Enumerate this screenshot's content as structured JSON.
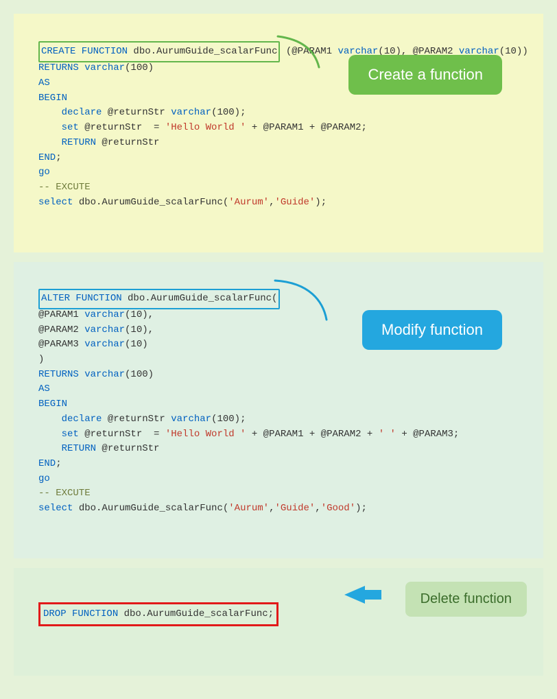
{
  "labels": {
    "create": "Create a function",
    "modify": "Modify function",
    "delete": "Delete function"
  },
  "code": {
    "create": {
      "l1a": "CREATE FUNCTION",
      "l1b": " dbo.AurumGuide_scalarFunc",
      "l1c": " (@PARAM1 ",
      "l1d": "varchar",
      "l1e": "(10), @PARAM2 ",
      "l1f": "varchar",
      "l1g": "(10))",
      "l2a": "RETURNS varchar",
      "l2b": "(100)",
      "l3": "AS",
      "l4": "BEGIN",
      "l5a": "    declare",
      "l5b": " @returnStr ",
      "l5c": "varchar",
      "l5d": "(100);",
      "l6a": "    set",
      "l6b": " @returnStr  = ",
      "l6c": "'Hello World '",
      "l6d": " + @PARAM1 + @PARAM2;",
      "l7a": "    RETURN",
      "l7b": " @returnStr",
      "l8a": "END",
      "l8b": ";",
      "l9": "go",
      "l10": "-- EXCUTE",
      "l11a": "select",
      "l11b": " dbo.AurumGuide_scalarFunc(",
      "l11c": "'Aurum'",
      "l11d": ",",
      "l11e": "'Guide'",
      "l11f": ");"
    },
    "alter": {
      "l1a": "ALTER FUNCTION",
      "l1b": " dbo.AurumGuide_scalarFunc(",
      "l2a": "@PARAM1 ",
      "l2b": "varchar",
      "l2c": "(10),",
      "l3a": "@PARAM2 ",
      "l3b": "varchar",
      "l3c": "(10),",
      "l4a": "@PARAM3 ",
      "l4b": "varchar",
      "l4c": "(10)",
      "l5": ")",
      "l6a": "RETURNS varchar",
      "l6b": "(100)",
      "l7": "AS",
      "l8": "BEGIN",
      "l9a": "    declare",
      "l9b": " @returnStr ",
      "l9c": "varchar",
      "l9d": "(100);",
      "l10a": "    set",
      "l10b": " @returnStr  = ",
      "l10c": "'Hello World '",
      "l10d": " + @PARAM1 + @PARAM2 + ",
      "l10e": "' '",
      "l10f": " + @PARAM3;",
      "l11a": "    RETURN",
      "l11b": " @returnStr",
      "l12a": "END",
      "l12b": ";",
      "l13": "go",
      "l14": "-- EXCUTE",
      "l15a": "select",
      "l15b": " dbo.AurumGuide_scalarFunc(",
      "l15c": "'Aurum'",
      "l15d": ",",
      "l15e": "'Guide'",
      "l15f": ",",
      "l15g": "'Good'",
      "l15h": ");"
    },
    "drop": {
      "l1a": "DROP FUNCTION",
      "l1b": " dbo.AurumGuide_scalarFunc;"
    }
  }
}
